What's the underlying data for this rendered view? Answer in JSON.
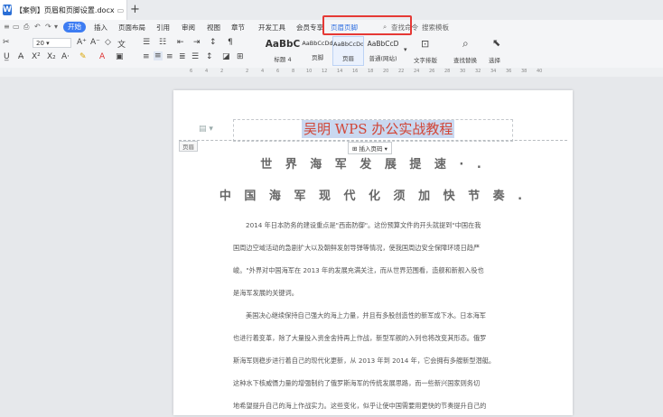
{
  "window": {
    "tab_title": "【案例】页眉和页脚设置.docx",
    "new_tab": "+"
  },
  "menu": {
    "items": [
      "开始",
      "插入",
      "页面布局",
      "引用",
      "审阅",
      "视图",
      "章节",
      "开发工具",
      "会员专享",
      "页眉页脚",
      "查找命令",
      "搜索模板"
    ],
    "active": "开始"
  },
  "ribbon": {
    "font_size": "20",
    "styles": [
      {
        "sample": "AaBbC",
        "name": "标题 4"
      },
      {
        "sample": "AaBbCcDd",
        "name": "页脚"
      },
      {
        "sample": "AaBbCcDd",
        "name": "页眉"
      },
      {
        "sample": "AaBbCcD",
        "name": "普通(网站)"
      }
    ],
    "text_arrange": "文字排版",
    "find_replace": "查找替换",
    "select": "选择"
  },
  "ruler": [
    "6",
    "4",
    "2",
    "2",
    "4",
    "6",
    "8",
    "10",
    "12",
    "14",
    "16",
    "18",
    "20",
    "22",
    "24",
    "26",
    "28",
    "30",
    "32",
    "34",
    "36",
    "38",
    "40"
  ],
  "document": {
    "header_text": "吴明 WPS 办公实战教程",
    "header_tag": "页眉",
    "insert_page_number": "插入页码",
    "title1": "世 界 海 军 发 展 提 速 · .",
    "title2": "中 国 海 军 现 代 化 须 加 快 节 奏 .",
    "paragraphs": [
      [
        "2014 年日本防务的建设重点是\"西南防御\"。这份预算文件的开头就提到\"中国在我",
        "国周边空域活动的急剧扩大以及朝鲜发射导弹等情况，使我国周边安全保障环境日趋严",
        "峻。\"外界对中国海军在 2013 年的发展充满关注，而从世界范围看，造舰和新舰入役也",
        "是海军发展的关键词。"
      ],
      [
        "美国决心继续保持自己强大的海上力量，并且有多股创造性的新军成下水。日本海军",
        "也进行着变革，除了大量投入资金舍持再上作战，新型军舰的入列也将改变其形态。俄罗",
        "斯海军则稳步进行着自己的现代化更新，从 2013 年到 2014 年，它会拥有多艘新型潜艇。",
        "这种水下核威慑力量的增强制约了俄罗斯海军的传统发展思路，而一些新兴国家则务切",
        "地希望提升自己的海上作战实力。这些变化，似乎让使中国需要用更快的节奏提升自己的"
      ]
    ]
  }
}
